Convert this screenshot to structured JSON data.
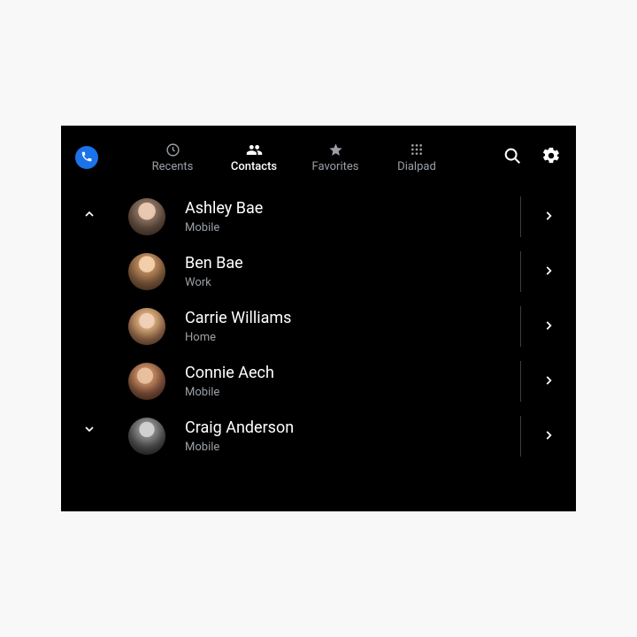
{
  "tabs": [
    {
      "label": "Recents"
    },
    {
      "label": "Contacts"
    },
    {
      "label": "Favorites"
    },
    {
      "label": "Dialpad"
    }
  ],
  "active_tab": "Contacts",
  "contacts": [
    {
      "name": "Ashley Bae",
      "sub": "Mobile"
    },
    {
      "name": "Ben Bae",
      "sub": "Work"
    },
    {
      "name": "Carrie Williams",
      "sub": "Home"
    },
    {
      "name": "Connie Aech",
      "sub": "Mobile"
    },
    {
      "name": "Craig Anderson",
      "sub": "Mobile"
    }
  ],
  "icons": {
    "phone": "phone-icon",
    "recents": "clock-icon",
    "contacts": "people-icon",
    "favorites": "star-icon",
    "dialpad": "dialpad-icon",
    "search": "search-icon",
    "settings": "gear-icon",
    "chevron_up": "chevron-up-icon",
    "chevron_down": "chevron-down-icon",
    "chevron_right": "chevron-right-icon"
  },
  "colors": {
    "accent": "#1a73e8",
    "background": "#000000",
    "text_primary": "#ffffff",
    "text_secondary": "#9aa0a6",
    "divider": "#3c4043"
  }
}
